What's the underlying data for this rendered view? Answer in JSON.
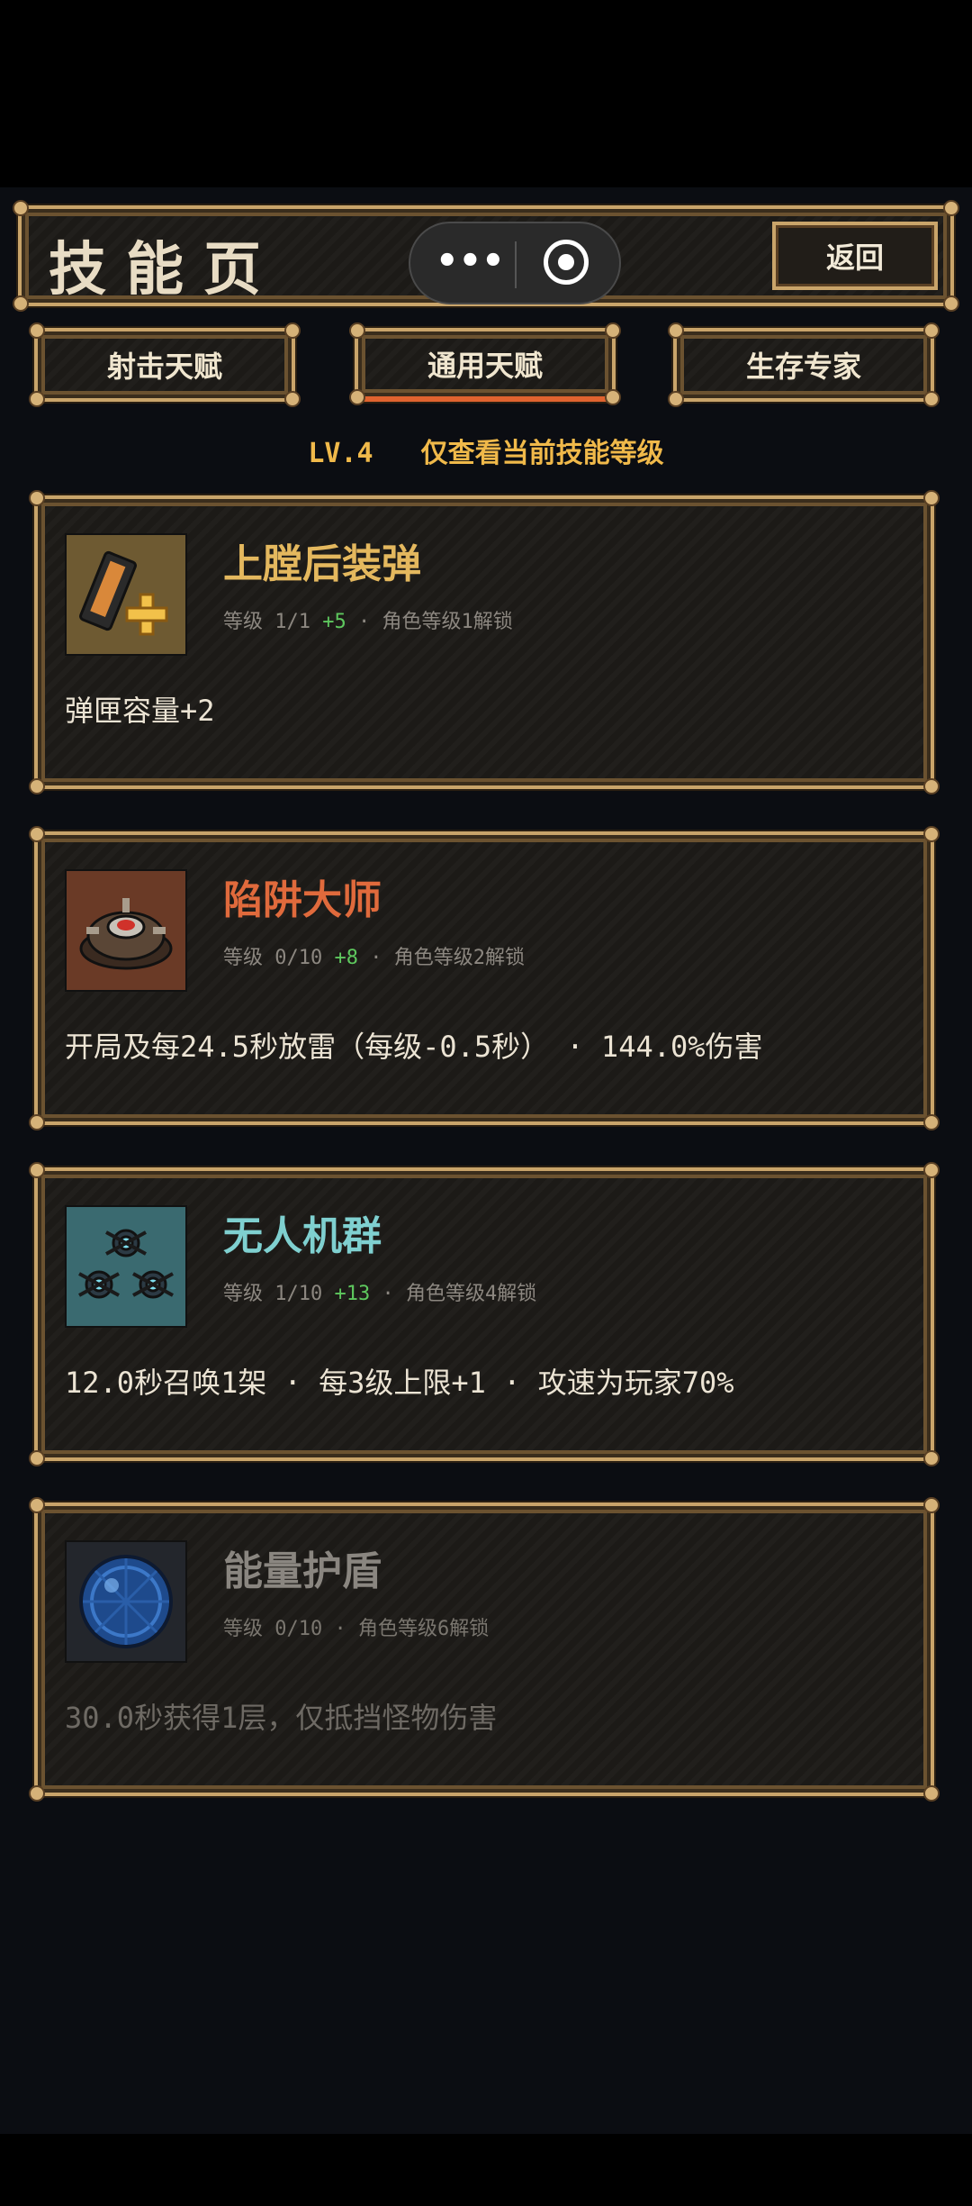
{
  "header": {
    "title": "技能页",
    "back_label": "返回"
  },
  "capsule": {
    "menu_icon": "more-dots-icon",
    "close_icon": "target-circle-icon"
  },
  "tabs": [
    {
      "label": "射击天赋",
      "active": false
    },
    {
      "label": "通用天赋",
      "active": true
    },
    {
      "label": "生存专家",
      "active": false
    }
  ],
  "level": {
    "lv": "LV.4",
    "note": "仅查看当前技能等级"
  },
  "skills": [
    {
      "name": "上膛后装弹",
      "level": "等级 1/1",
      "bonus": "+5",
      "unlock": "· 角色等级1解锁",
      "desc": "弹匣容量+2",
      "icon": "magazine-plus-icon",
      "name_color": "#e4b85e"
    },
    {
      "name": "陷阱大师",
      "level": "等级 0/10",
      "bonus": "+8",
      "unlock": "· 角色等级2解锁",
      "desc": "开局及每24.5秒放雷（每级-0.5秒） · 144.0%伤害",
      "icon": "landmine-icon",
      "name_color": "#e06a3c"
    },
    {
      "name": "无人机群",
      "level": "等级 1/10",
      "bonus": "+13",
      "unlock": "· 角色等级4解锁",
      "desc": "12.0秒召唤1架 · 每3级上限+1 · 攻速为玩家70%",
      "icon": "drone-swarm-icon",
      "name_color": "#7fd0d0"
    },
    {
      "name": "能量护盾",
      "level": "等级 0/10",
      "bonus": "",
      "unlock": "· 角色等级6解锁",
      "desc": "30.0秒获得1层，仅抵挡怪物伤害",
      "icon": "energy-shield-icon",
      "name_color": "#8a8680"
    }
  ]
}
